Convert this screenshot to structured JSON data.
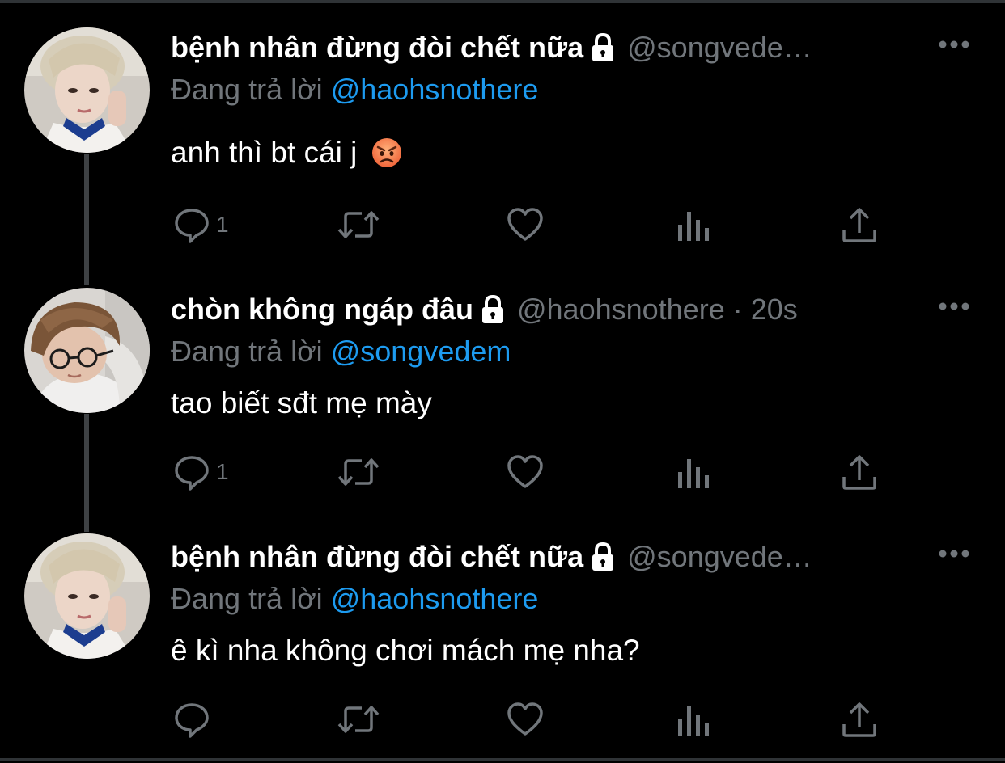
{
  "tweets": [
    {
      "display_name": "bệnh nhân đừng đòi chết nữa",
      "handle": "@songvede…",
      "time": "",
      "reply_prefix": "Đang trả lời",
      "reply_to": "@haohsnothere",
      "text": "anh thì bt cái j",
      "emoji": "angry-face-icon",
      "reply_count": "1",
      "avatar": "avatar-blonde"
    },
    {
      "display_name": "chòn không ngáp đâu",
      "handle": "@haohsnothere",
      "dot": "·",
      "time": "20s",
      "reply_prefix": "Đang trả lời",
      "reply_to": "@songvedem",
      "text": "tao biết sđt mẹ mày",
      "reply_count": "1",
      "avatar": "avatar-brown-hair-glasses"
    },
    {
      "display_name": "bệnh nhân đừng đòi chết nữa",
      "handle": "@songvede…",
      "time": "",
      "reply_prefix": "Đang trả lời",
      "reply_to": "@haohsnothere",
      "text": "ê kì nha không chơi mách mẹ nha?",
      "reply_count": "",
      "avatar": "avatar-blonde"
    }
  ],
  "colors": {
    "background": "#000000",
    "text": "#ffffff",
    "muted": "#71767b",
    "link": "#1d9bf0",
    "thread_line": "#3e4144"
  },
  "icons": [
    "lock-icon",
    "more-icon",
    "reply-icon",
    "retweet-icon",
    "like-icon",
    "views-icon",
    "share-icon"
  ]
}
